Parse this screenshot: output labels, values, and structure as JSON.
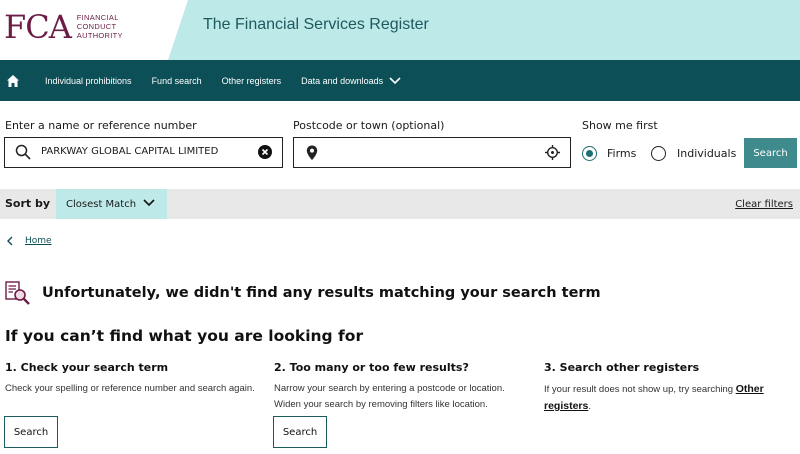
{
  "header": {
    "logo_mark": "FCA",
    "logo_lines": [
      "FINANCIAL",
      "CONDUCT",
      "AUTHORITY"
    ],
    "title": "The Financial Services Register",
    "band_color": "#bde9e8",
    "brand_color": "#6b1d46"
  },
  "nav": {
    "home_icon": "home-icon",
    "items": [
      {
        "label": "Individual prohibitions"
      },
      {
        "label": "Fund search"
      },
      {
        "label": "Other registers"
      },
      {
        "label": "Data and downloads"
      }
    ]
  },
  "search": {
    "name_label": "Enter a name or reference number",
    "name_value": "PARKWAY GLOBAL CAPITAL LIMITED",
    "postcode_label": "Postcode or town (optional)",
    "postcode_value": "",
    "show_label": "Show me first",
    "options": [
      {
        "label": "Firms",
        "selected": true
      },
      {
        "label": "Individuals",
        "selected": false
      }
    ],
    "button": "Search"
  },
  "sort": {
    "label": "Sort by",
    "selected": "Closest Match",
    "clear": "Clear filters"
  },
  "breadcrumb": {
    "home": "Home"
  },
  "results": {
    "message": "Unfortunately, we didn't find any results matching your search term"
  },
  "help": {
    "title": "If you can’t find what you are looking for",
    "columns": [
      {
        "heading": "1. Check your search term",
        "text": "Check your spelling or reference number and search again.",
        "button": "Search"
      },
      {
        "heading": "2. Too many or too few results?",
        "text": "Narrow your search by entering a postcode or location. Widen your search by removing filters like location.",
        "button": "Search"
      },
      {
        "heading": "3. Search other registers",
        "text_before": "If your result does not show up, try searching ",
        "link": "Other registers",
        "text_after": "."
      }
    ]
  }
}
